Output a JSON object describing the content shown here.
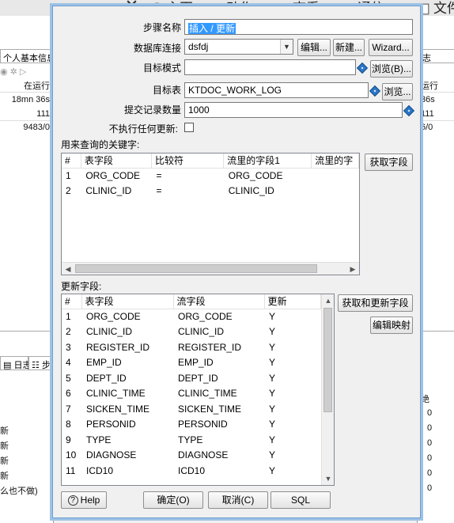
{
  "background": {
    "menu": [
      {
        "icon": "close-icon",
        "label": ""
      },
      {
        "icon": "home-icon",
        "label": "主页"
      },
      {
        "icon": "action-icon",
        "label": "动作"
      },
      {
        "icon": "view-icon",
        "label": "查看"
      },
      {
        "icon": "communication-icon",
        "label": "通信"
      },
      {
        "icon": "file-icon",
        "label": "文件"
      }
    ],
    "left_tab": "个人基本信息",
    "left_status": "在运行",
    "left_values": [
      "18mn 36s",
      "111",
      "9483/0"
    ],
    "left_log_tab": "日志",
    "left_step_tab": "步",
    "left_lines": [
      "新",
      "新",
      "新",
      "新",
      "么也不做)"
    ],
    "right_tab": "志",
    "right_status": "运行",
    "right_values": [
      "36s",
      "111",
      "6/0"
    ],
    "right_col": "绝",
    "right_zeros": [
      "0",
      "0",
      "0",
      "0",
      "0",
      "0"
    ]
  },
  "dialog": {
    "step_name_label": "步骤名称",
    "step_name_value": "插入 / 更新",
    "db_conn_label": "数据库连接",
    "db_conn_value": "dsfdj",
    "edit_btn": "编辑...",
    "new_btn": "新建...",
    "wizard_btn": "Wizard...",
    "schema_label": "目标模式",
    "schema_value": "",
    "browse_schema_btn": "浏览(B)...",
    "table_label": "目标表",
    "table_value": "KTDOC_WORK_LOG",
    "browse_table_btn": "浏览...",
    "commit_label": "提交记录数量",
    "commit_value": "1000",
    "no_update_label": "不执行任何更新:",
    "no_update_checked": false,
    "keys_label": "用来查询的关键字:",
    "get_fields_btn": "获取字段",
    "keys_table": {
      "headers": [
        "#",
        "表字段",
        "比较符",
        "流里的字段1",
        "流里的字"
      ],
      "rows": [
        [
          "1",
          "ORG_CODE",
          "=",
          "ORG_CODE",
          ""
        ],
        [
          "2",
          "CLINIC_ID",
          "=",
          "CLINIC_ID",
          ""
        ]
      ]
    },
    "update_label": "更新字段:",
    "get_update_fields_btn": "获取和更新字段",
    "edit_mapping_btn": "编辑映射",
    "update_table": {
      "headers": [
        "#",
        "表字段",
        "流字段",
        "更新"
      ],
      "rows": [
        [
          "1",
          "ORG_CODE",
          "ORG_CODE",
          "Y"
        ],
        [
          "2",
          "CLINIC_ID",
          "CLINIC_ID",
          "Y"
        ],
        [
          "3",
          "REGISTER_ID",
          "REGISTER_ID",
          "Y"
        ],
        [
          "4",
          "EMP_ID",
          "EMP_ID",
          "Y"
        ],
        [
          "5",
          "DEPT_ID",
          "DEPT_ID",
          "Y"
        ],
        [
          "6",
          "CLINIC_TIME",
          "CLINIC_TIME",
          "Y"
        ],
        [
          "7",
          "SICKEN_TIME",
          "SICKEN_TIME",
          "Y"
        ],
        [
          "8",
          "PERSONID",
          "PERSONID",
          "Y"
        ],
        [
          "9",
          "TYPE",
          "TYPE",
          "Y"
        ],
        [
          "10",
          "DIAGNOSE",
          "DIAGNOSE",
          "Y"
        ],
        [
          "11",
          "ICD10",
          "ICD10",
          "Y"
        ]
      ]
    },
    "help_btn": "Help",
    "ok_btn": "确定(O)",
    "cancel_btn": "取消(C)",
    "sql_btn": "SQL"
  }
}
